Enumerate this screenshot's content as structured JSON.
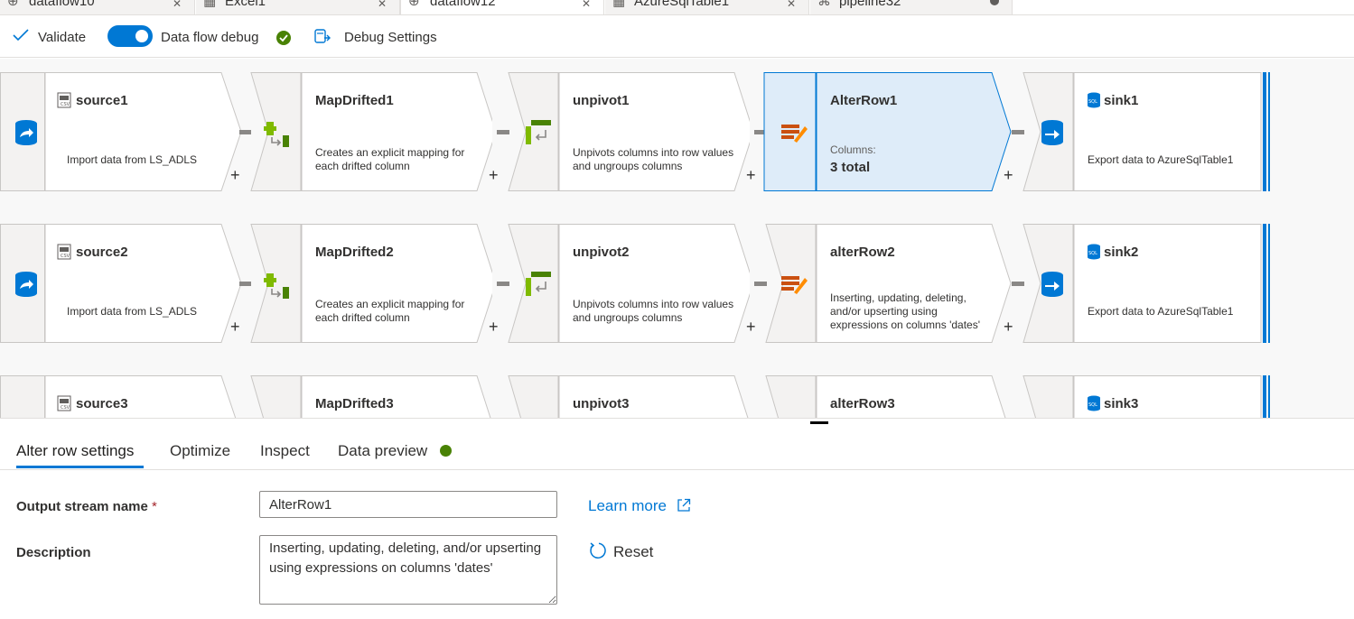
{
  "tabs": [
    {
      "label": "dataflow10",
      "icon": "dataflow-icon"
    },
    {
      "label": "Excel1",
      "icon": "table-icon"
    },
    {
      "label": "dataflow12",
      "icon": "dataflow-icon",
      "active": true
    },
    {
      "label": "AzureSqlTable1",
      "icon": "table-icon"
    },
    {
      "label": "pipeline32",
      "icon": "pipeline-icon"
    }
  ],
  "toolbar": {
    "validate": "Validate",
    "debug": "Data flow debug",
    "debug_settings": "Debug Settings"
  },
  "rows": [
    {
      "source": {
        "title": "source1",
        "desc": "Import data from LS_ADLS"
      },
      "map": {
        "title": "MapDrifted1",
        "desc": "Creates an explicit mapping for each drifted column"
      },
      "unpivot": {
        "title": "unpivot1",
        "desc": "Unpivots columns into row values and ungroups columns"
      },
      "alter": {
        "title": "AlterRow1",
        "label": "Columns:",
        "value": "3 total"
      },
      "sink": {
        "title": "sink1",
        "desc": "Export data to AzureSqlTable1"
      }
    },
    {
      "source": {
        "title": "source2",
        "desc": "Import data from LS_ADLS"
      },
      "map": {
        "title": "MapDrifted2",
        "desc": "Creates an explicit mapping for each drifted column"
      },
      "unpivot": {
        "title": "unpivot2",
        "desc": "Unpivots columns into row values and ungroups columns"
      },
      "alter": {
        "title": "alterRow2",
        "desc": "Inserting, updating, deleting, and/or upserting using expressions on columns 'dates'"
      },
      "sink": {
        "title": "sink2",
        "desc": "Export data to AzureSqlTable1"
      }
    },
    {
      "source": {
        "title": "source3"
      },
      "map": {
        "title": "MapDrifted3"
      },
      "unpivot": {
        "title": "unpivot3"
      },
      "alter": {
        "title": "alterRow3"
      },
      "sink": {
        "title": "sink3"
      }
    }
  ],
  "plus": "+",
  "panel": {
    "tabs": [
      "Alter row settings",
      "Optimize",
      "Inspect",
      "Data preview"
    ],
    "output_label": "Output stream name",
    "required_mark": "*",
    "output_value": "AlterRow1",
    "description_label": "Description",
    "description_value": "Inserting, updating, deleting, and/or upserting using expressions on columns 'dates'",
    "learn_more": "Learn more",
    "reset": "Reset"
  },
  "colors": {
    "accent": "#0078d4",
    "ok": "#498205",
    "selected_fill": "#deecf9"
  }
}
